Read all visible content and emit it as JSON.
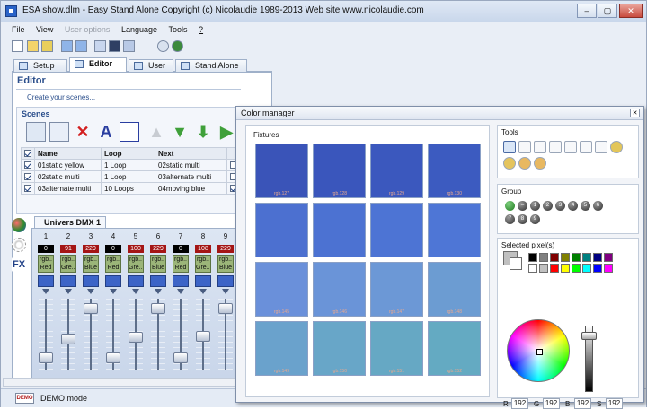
{
  "window": {
    "title": "ESA show.dlm - Easy Stand Alone   Copyright (c) Nicolaudie 1989-2013   Web site www.nicolaudie.com",
    "minimize": "–",
    "maximize": "▢",
    "close": "✕"
  },
  "menu": [
    "File",
    "View",
    "User options",
    "Language",
    "Tools",
    "?"
  ],
  "tabs": [
    "Setup",
    "Editor",
    "User",
    "Stand Alone"
  ],
  "editor": {
    "title": "Editor",
    "create_link": "Create your scenes...",
    "scenes_title": "Scenes"
  },
  "scenes_table": {
    "headers": [
      "Name",
      "Loop",
      "Next"
    ],
    "rows": [
      {
        "checked": true,
        "name": "01static yellow",
        "loop": "1 Loop",
        "next": "02static multi",
        "extra_checked": false
      },
      {
        "checked": true,
        "name": "02static multi",
        "loop": "1 Loop",
        "next": "03alternate multi",
        "extra_checked": false
      },
      {
        "checked": true,
        "name": "03alternate multi",
        "loop": "10 Loops",
        "next": "04moving blue",
        "extra_checked": true
      }
    ]
  },
  "dmx": {
    "tab": "Univers DMX 1",
    "channels": [
      {
        "num": "1",
        "value": "0",
        "color": "black",
        "label": "rgb..\nRed",
        "level": 0.12
      },
      {
        "num": "2",
        "value": "91",
        "color": "red",
        "label": "rgb..\nGre...",
        "level": 0.42
      },
      {
        "num": "3",
        "value": "229",
        "color": "red",
        "label": "rgb..\nBlue",
        "level": 0.93
      },
      {
        "num": "4",
        "value": "0",
        "color": "black",
        "label": "rgb..\nRed",
        "level": 0.12
      },
      {
        "num": "5",
        "value": "100",
        "color": "red",
        "label": "rgb..\nGre...",
        "level": 0.45
      },
      {
        "num": "6",
        "value": "229",
        "color": "red",
        "label": "rgb..\nBlue",
        "level": 0.93
      },
      {
        "num": "7",
        "value": "0",
        "color": "black",
        "label": "rgb..\nRed",
        "level": 0.12
      },
      {
        "num": "8",
        "value": "108",
        "color": "red",
        "label": "rgb..\nGre...",
        "level": 0.47
      },
      {
        "num": "9",
        "value": "229",
        "color": "red",
        "label": "rgb..\nBlue",
        "level": 0.93
      }
    ]
  },
  "status": {
    "demo_icon": "DEMO",
    "text": "DEMO mode"
  },
  "color_manager": {
    "title": "Color manager",
    "close": "✕",
    "fixtures_label": "Fixtures",
    "fixtures": [
      {
        "color": "#3a54b8",
        "label": "rgb.127"
      },
      {
        "color": "#3a56bc",
        "label": "rgb.128"
      },
      {
        "color": "#3b58be",
        "label": "rgb.129"
      },
      {
        "color": "#3c5bc0",
        "label": "rgb.130"
      },
      {
        "color": "#4c70d0",
        "label": ""
      },
      {
        "color": "#4c72d2",
        "label": ""
      },
      {
        "color": "#4d74d4",
        "label": ""
      },
      {
        "color": "#4e76d6",
        "label": ""
      },
      {
        "color": "#6a90da",
        "label": "rgb.145"
      },
      {
        "color": "#6a94d8",
        "label": "rgb.146"
      },
      {
        "color": "#6c98d6",
        "label": "rgb.147"
      },
      {
        "color": "#6c9cd2",
        "label": "rgb.148"
      },
      {
        "color": "#6aa2cc",
        "label": "rgb.149"
      },
      {
        "color": "#68a6c8",
        "label": "rgb.150"
      },
      {
        "color": "#66a8c4",
        "label": "rgb.151"
      },
      {
        "color": "#64aac2",
        "label": "rgb.152"
      }
    ],
    "tools_title": "Tools",
    "group_title": "Group",
    "group_buttons": [
      "+",
      "–",
      "1",
      "2",
      "3",
      "4",
      "5",
      "6",
      "7",
      "8",
      "9"
    ],
    "selected_title": "Selected pixel(s)",
    "palette": [
      "#000000",
      "#808080",
      "#800000",
      "#808000",
      "#008000",
      "#008080",
      "#000080",
      "#800080",
      "#ffffff",
      "#c0c0c0",
      "#ff0000",
      "#ffff00",
      "#00ff00",
      "#00ffff",
      "#0000ff",
      "#ff00ff"
    ],
    "rgb": {
      "r_label": "R",
      "r": "192",
      "g_label": "G",
      "g": "192",
      "b_label": "B",
      "b": "192",
      "s_label": "S",
      "s": "192"
    }
  }
}
